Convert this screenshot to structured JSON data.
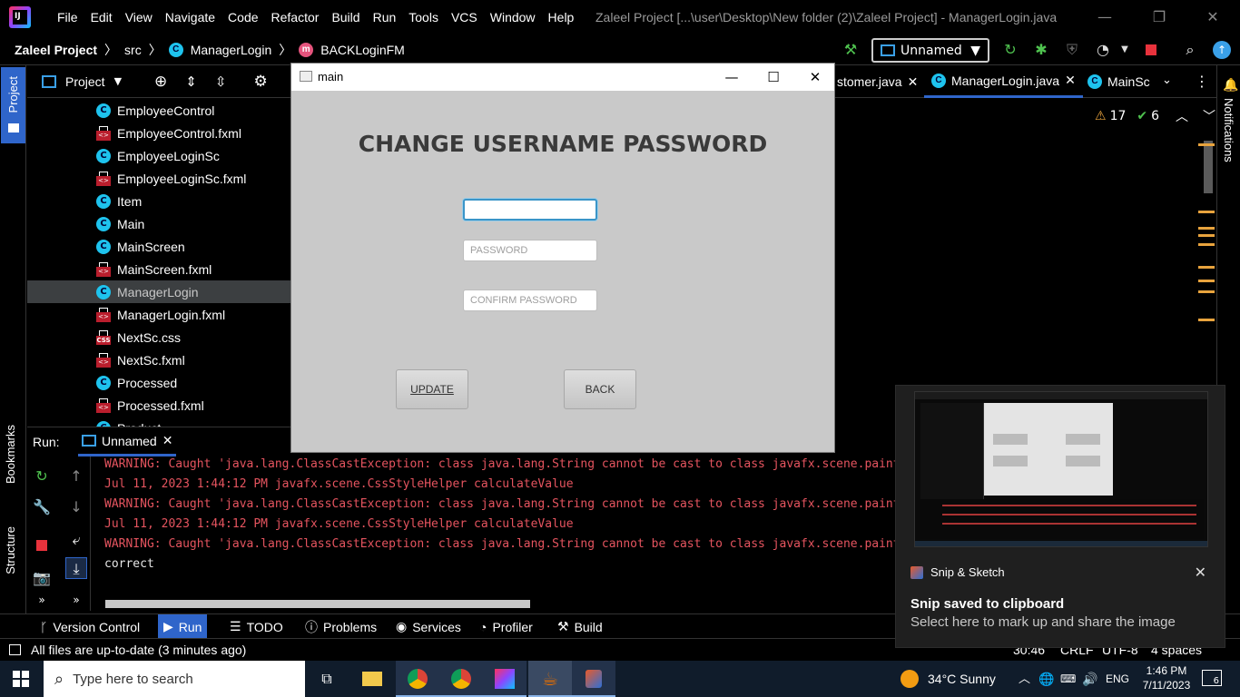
{
  "ide": {
    "title": "Zaleel Project [...\\user\\Desktop\\New folder (2)\\Zaleel Project] - ManagerLogin.java",
    "menu": [
      "File",
      "Edit",
      "View",
      "Navigate",
      "Code",
      "Refactor",
      "Build",
      "Run",
      "Tools",
      "VCS",
      "Window",
      "Help"
    ],
    "breadcrumb": {
      "project": "Zaleel Project",
      "src": "src",
      "class": "ManagerLogin",
      "method": "BACKLoginFM"
    },
    "run_config": "Unnamed",
    "left_tabs": {
      "project": "Project",
      "bookmarks": "Bookmarks",
      "structure": "Structure"
    },
    "right_tabs": {
      "notifications": "Notifications"
    },
    "project_panel": {
      "title": "Project",
      "items": [
        {
          "label": "EmployeeControl",
          "type": "class"
        },
        {
          "label": "EmployeeControl.fxml",
          "type": "fxml"
        },
        {
          "label": "EmployeeLoginSc",
          "type": "class"
        },
        {
          "label": "EmployeeLoginSc.fxml",
          "type": "fxml"
        },
        {
          "label": "Item",
          "type": "class"
        },
        {
          "label": "Main",
          "type": "class"
        },
        {
          "label": "MainScreen",
          "type": "class"
        },
        {
          "label": "MainScreen.fxml",
          "type": "fxml"
        },
        {
          "label": "ManagerLogin",
          "type": "class",
          "selected": true
        },
        {
          "label": "ManagerLogin.fxml",
          "type": "fxml"
        },
        {
          "label": "NextSc.css",
          "type": "css"
        },
        {
          "label": "NextSc.fxml",
          "type": "fxml"
        },
        {
          "label": "Processed",
          "type": "class"
        },
        {
          "label": "Processed.fxml",
          "type": "fxml"
        },
        {
          "label": "Product",
          "type": "class"
        }
      ]
    },
    "editor_tabs": [
      {
        "label": "stomer.java",
        "active": false
      },
      {
        "label": "ManagerLogin.java",
        "active": true
      },
      {
        "label": "MainSc",
        "active": false
      }
    ],
    "inspections": {
      "warnings": "17",
      "ok": "6"
    },
    "run_panel": {
      "label": "Run:",
      "tab": "Unnamed",
      "lines": [
        {
          "text": "WARNING: Caught 'java.lang.ClassCastException: class java.lang.String cannot be cast to class javafx.scene.paint.Paint",
          "color": "#e5545f"
        },
        {
          "text": "Jul 11, 2023 1:44:12 PM javafx.scene.CssStyleHelper calculateValue",
          "color": "#e5545f"
        },
        {
          "text": "WARNING: Caught 'java.lang.ClassCastException: class java.lang.String cannot be cast to class javafx.scene.paint.Paint",
          "color": "#e5545f"
        },
        {
          "text": "Jul 11, 2023 1:44:12 PM javafx.scene.CssStyleHelper calculateValue",
          "color": "#e5545f"
        },
        {
          "text": "WARNING: Caught 'java.lang.ClassCastException: class java.lang.String cannot be cast to class javafx.scene.paint.Paint",
          "color": "#e5545f"
        },
        {
          "text": "correct",
          "color": "#e6e6e6"
        }
      ]
    },
    "bottom_tools": [
      {
        "label": "Version Control",
        "icon": "branch-icon",
        "active": false
      },
      {
        "label": "Run",
        "icon": "play-icon",
        "active": true
      },
      {
        "label": "TODO",
        "icon": "list-icon",
        "active": false
      },
      {
        "label": "Problems",
        "icon": "problems-icon",
        "active": false
      },
      {
        "label": "Services",
        "icon": "services-icon",
        "active": false
      },
      {
        "label": "Profiler",
        "icon": "profiler-icon",
        "active": false
      },
      {
        "label": "Build",
        "icon": "hammer-icon",
        "active": false
      }
    ],
    "status": {
      "message": "All files are up-to-date (3 minutes ago)",
      "position": "30:46",
      "line_sep": "CRLF",
      "encoding": "UTF-8",
      "indent": "4 spaces"
    }
  },
  "fx_window": {
    "title": "main",
    "heading": "CHANGE USERNAME PASSWORD",
    "username_value": "",
    "password_placeholder": "PASSWORD",
    "confirm_placeholder": "CONFIRM PASSWORD",
    "update_label": "UPDATE",
    "back_label": "BACK"
  },
  "toast": {
    "app": "Snip & Sketch",
    "heading": "Snip saved to clipboard",
    "body": "Select here to mark up and share the image"
  },
  "taskbar": {
    "search_placeholder": "Type here to search",
    "weather": "34°C  Sunny",
    "lang": "ENG",
    "time": "1:46 PM",
    "date": "7/11/2023",
    "notif_count": "6"
  },
  "colors": {
    "accent": "#2f65ca",
    "class_icon": "#1ec3ee",
    "console_error": "#e5545f",
    "fx_bg": "#c9c9c9"
  }
}
